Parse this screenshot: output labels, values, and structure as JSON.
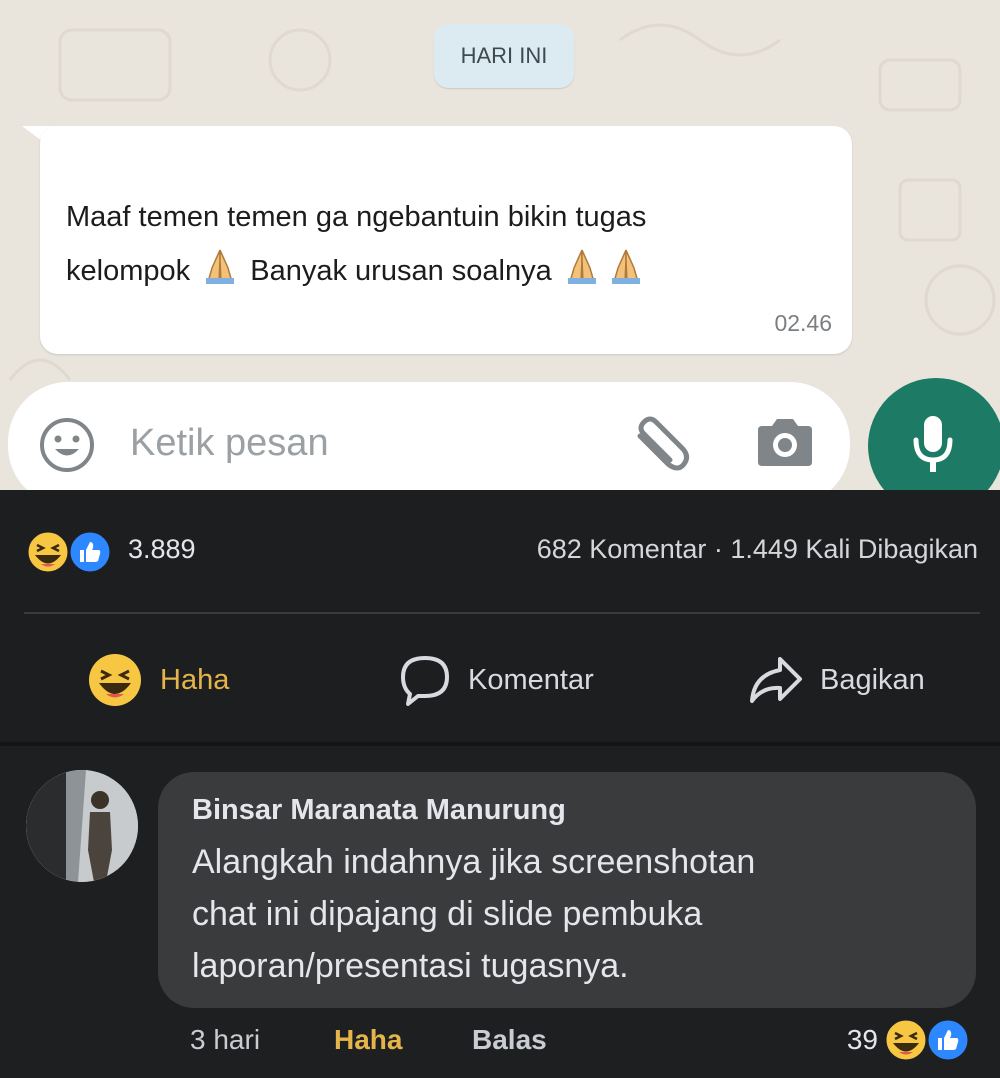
{
  "chat": {
    "date_chip": "HARI INI",
    "message_line1": "Maaf temen temen ga ngebantuin bikin tugas",
    "message_line2a": "kelompok",
    "message_line2b": "Banyak urusan soalnya",
    "message_time": "02.46",
    "input_placeholder": "Ketik pesan"
  },
  "post": {
    "reactions_count": "3.889",
    "comments_shares": "682 Komentar · 1.449 Kali Dibagikan",
    "actions": {
      "haha": "Haha",
      "comment": "Komentar",
      "share": "Bagikan"
    }
  },
  "comment": {
    "author": "Binsar Maranata Manurung",
    "line1": "Alangkah indahnya jika screenshotan",
    "line2": "chat ini dipajang di slide pembuka",
    "line3": "laporan/presentasi tugasnya.",
    "time": "3 hari",
    "reaction_label": "Haha",
    "reply_label": "Balas",
    "reaction_count": "39"
  },
  "colors": {
    "wa_green": "#1d7a64",
    "fb_background": "#1d1e20",
    "haha_yellow": "#e6b54a",
    "like_blue": "#2d88ff"
  },
  "icons": [
    "smiley-icon",
    "paperclip-icon",
    "camera-icon",
    "mic-icon",
    "haha-icon",
    "like-icon",
    "comment-icon",
    "share-arrow-icon",
    "folded-hands-icon"
  ]
}
